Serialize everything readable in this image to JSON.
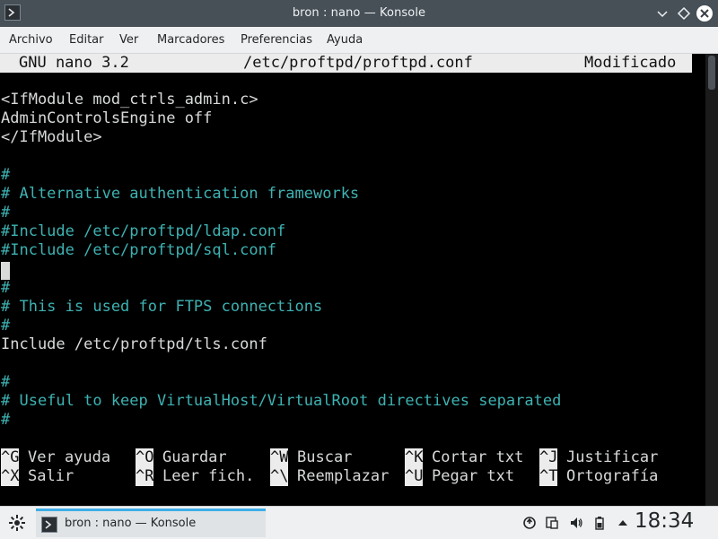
{
  "window": {
    "title": "bron : nano — Konsole"
  },
  "menubar": {
    "items": [
      "Archivo",
      "Editar",
      "Ver",
      "Marcadores",
      "Preferencias",
      "Ayuda"
    ]
  },
  "nano": {
    "version": "GNU nano 3.2",
    "filename": "/etc/proftpd/proftpd.conf",
    "status": "Modificado"
  },
  "editor": {
    "lines": [
      "<IfModule mod_ctrls_admin.c>",
      "AdminControlsEngine off",
      "</IfModule>",
      "",
      "#",
      "# Alternative authentication frameworks",
      "#",
      "#Include /etc/proftpd/ldap.conf",
      "#Include /etc/proftpd/sql.conf",
      "",
      "#",
      "# This is used for FTPS connections",
      "#",
      "Include /etc/proftpd/tls.conf",
      "",
      "#",
      "# Useful to keep VirtualHost/VirtualRoot directives separated",
      "#"
    ],
    "colors": {
      "text": "#d8dada",
      "comment": "#3eb2b2",
      "background": "#000000"
    }
  },
  "shortcuts": {
    "row1": [
      {
        "key": "^G",
        "label": "Ver ayuda"
      },
      {
        "key": "^O",
        "label": "Guardar"
      },
      {
        "key": "^W",
        "label": "Buscar"
      },
      {
        "key": "^K",
        "label": "Cortar txt"
      },
      {
        "key": "^J",
        "label": "Justificar"
      }
    ],
    "row2": [
      {
        "key": "^X",
        "label": "Salir"
      },
      {
        "key": "^R",
        "label": "Leer fich."
      },
      {
        "key": "^\\",
        "label": "Reemplazar"
      },
      {
        "key": "^U",
        "label": "Pegar txt"
      },
      {
        "key": "^T",
        "label": "Ortografía"
      }
    ]
  },
  "taskbar": {
    "task_label": "bron : nano — Konsole",
    "clock": "18:34",
    "accent": "#3daee9",
    "tray_icons": [
      "update-icon",
      "clipboard-icon",
      "volume-icon",
      "battery-icon",
      "expand-tray-icon"
    ]
  }
}
